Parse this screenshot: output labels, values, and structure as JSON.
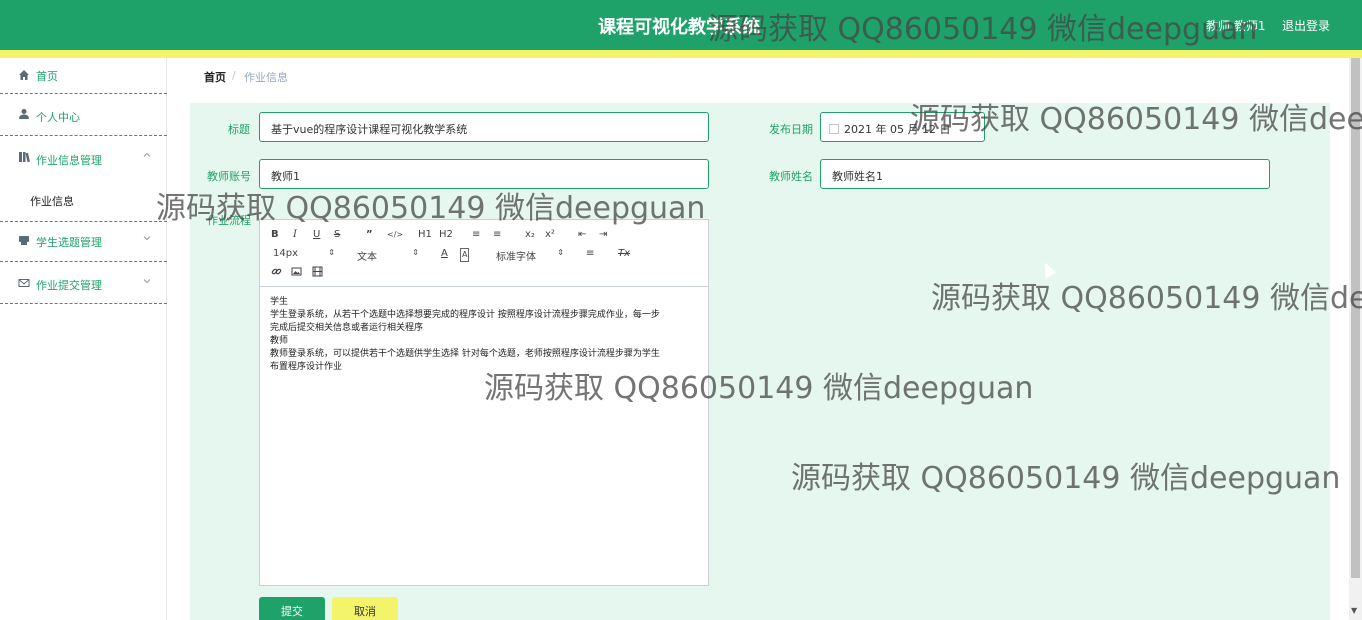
{
  "header": {
    "title": "课程可视化教学系统",
    "user": "教师 教师1",
    "logout": "退出登录"
  },
  "colors": {
    "primary": "#1fa26a",
    "accent": "#f4f46b",
    "form_bg": "#e6f7ef"
  },
  "sidebar": {
    "items": [
      {
        "icon": "home-icon",
        "label": "首页"
      },
      {
        "icon": "user-icon",
        "label": "个人中心"
      },
      {
        "icon": "book-icon",
        "label": "作业信息管理",
        "expanded": true,
        "children": [
          {
            "label": "作业信息"
          }
        ]
      },
      {
        "icon": "folder-icon",
        "label": "学生选题管理"
      },
      {
        "icon": "mail-icon",
        "label": "作业提交管理"
      }
    ]
  },
  "breadcrumb": {
    "home": "首页",
    "sep": "/",
    "current": "作业信息"
  },
  "form": {
    "title_label": "标题",
    "title_value": "基于vue的程序设计课程可视化教学系统",
    "date_label": "发布日期",
    "date_value": "2021 年 05 月 12 日",
    "teacher_account_label": "教师账号",
    "teacher_account_value": "教师1",
    "teacher_name_label": "教师姓名",
    "teacher_name_value": "教师姓名1",
    "process_label": "作业流程",
    "submit": "提交",
    "cancel": "取消"
  },
  "editor": {
    "toolbar": {
      "bold": "B",
      "italic": "I",
      "underline": "U",
      "strike": "S",
      "quote": "”",
      "code": "</>",
      "h1": "H1",
      "h2": "H2",
      "ol": "≡",
      "ul": "≡",
      "sub": "x₂",
      "sup": "x²",
      "outdent": "⇤",
      "indent": "⇥",
      "size": "14px",
      "header": "文本",
      "color": "A",
      "background": "A",
      "font": "标准字体",
      "align": "≡",
      "clean": "Tx",
      "link": "🔗",
      "image": "▣",
      "video": "▦"
    },
    "lines": [
      "学生",
      "学生登录系统，从若干个选题中选择想要完成的程序设计 按照程序设计流程步骤完成作业，每一步",
      "完成后提交相关信息或者运行相关程序",
      "教师",
      "教师登录系统，可以提供若干个选题供学生选择 针对每个选题，老师按照程序设计流程步骤为学生",
      "布置程序设计作业"
    ]
  },
  "watermark": "源码获取 QQ86050149 微信deepguan"
}
